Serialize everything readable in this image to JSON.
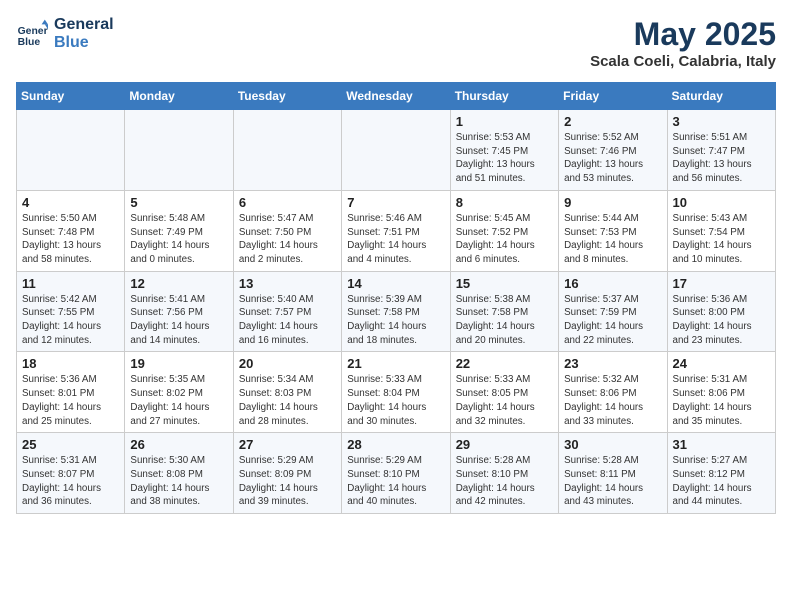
{
  "logo": {
    "line1": "General",
    "line2": "Blue"
  },
  "title": "May 2025",
  "location": "Scala Coeli, Calabria, Italy",
  "weekdays": [
    "Sunday",
    "Monday",
    "Tuesday",
    "Wednesday",
    "Thursday",
    "Friday",
    "Saturday"
  ],
  "weeks": [
    [
      {
        "day": "",
        "info": ""
      },
      {
        "day": "",
        "info": ""
      },
      {
        "day": "",
        "info": ""
      },
      {
        "day": "",
        "info": ""
      },
      {
        "day": "1",
        "info": "Sunrise: 5:53 AM\nSunset: 7:45 PM\nDaylight: 13 hours\nand 51 minutes."
      },
      {
        "day": "2",
        "info": "Sunrise: 5:52 AM\nSunset: 7:46 PM\nDaylight: 13 hours\nand 53 minutes."
      },
      {
        "day": "3",
        "info": "Sunrise: 5:51 AM\nSunset: 7:47 PM\nDaylight: 13 hours\nand 56 minutes."
      }
    ],
    [
      {
        "day": "4",
        "info": "Sunrise: 5:50 AM\nSunset: 7:48 PM\nDaylight: 13 hours\nand 58 minutes."
      },
      {
        "day": "5",
        "info": "Sunrise: 5:48 AM\nSunset: 7:49 PM\nDaylight: 14 hours\nand 0 minutes."
      },
      {
        "day": "6",
        "info": "Sunrise: 5:47 AM\nSunset: 7:50 PM\nDaylight: 14 hours\nand 2 minutes."
      },
      {
        "day": "7",
        "info": "Sunrise: 5:46 AM\nSunset: 7:51 PM\nDaylight: 14 hours\nand 4 minutes."
      },
      {
        "day": "8",
        "info": "Sunrise: 5:45 AM\nSunset: 7:52 PM\nDaylight: 14 hours\nand 6 minutes."
      },
      {
        "day": "9",
        "info": "Sunrise: 5:44 AM\nSunset: 7:53 PM\nDaylight: 14 hours\nand 8 minutes."
      },
      {
        "day": "10",
        "info": "Sunrise: 5:43 AM\nSunset: 7:54 PM\nDaylight: 14 hours\nand 10 minutes."
      }
    ],
    [
      {
        "day": "11",
        "info": "Sunrise: 5:42 AM\nSunset: 7:55 PM\nDaylight: 14 hours\nand 12 minutes."
      },
      {
        "day": "12",
        "info": "Sunrise: 5:41 AM\nSunset: 7:56 PM\nDaylight: 14 hours\nand 14 minutes."
      },
      {
        "day": "13",
        "info": "Sunrise: 5:40 AM\nSunset: 7:57 PM\nDaylight: 14 hours\nand 16 minutes."
      },
      {
        "day": "14",
        "info": "Sunrise: 5:39 AM\nSunset: 7:58 PM\nDaylight: 14 hours\nand 18 minutes."
      },
      {
        "day": "15",
        "info": "Sunrise: 5:38 AM\nSunset: 7:58 PM\nDaylight: 14 hours\nand 20 minutes."
      },
      {
        "day": "16",
        "info": "Sunrise: 5:37 AM\nSunset: 7:59 PM\nDaylight: 14 hours\nand 22 minutes."
      },
      {
        "day": "17",
        "info": "Sunrise: 5:36 AM\nSunset: 8:00 PM\nDaylight: 14 hours\nand 23 minutes."
      }
    ],
    [
      {
        "day": "18",
        "info": "Sunrise: 5:36 AM\nSunset: 8:01 PM\nDaylight: 14 hours\nand 25 minutes."
      },
      {
        "day": "19",
        "info": "Sunrise: 5:35 AM\nSunset: 8:02 PM\nDaylight: 14 hours\nand 27 minutes."
      },
      {
        "day": "20",
        "info": "Sunrise: 5:34 AM\nSunset: 8:03 PM\nDaylight: 14 hours\nand 28 minutes."
      },
      {
        "day": "21",
        "info": "Sunrise: 5:33 AM\nSunset: 8:04 PM\nDaylight: 14 hours\nand 30 minutes."
      },
      {
        "day": "22",
        "info": "Sunrise: 5:33 AM\nSunset: 8:05 PM\nDaylight: 14 hours\nand 32 minutes."
      },
      {
        "day": "23",
        "info": "Sunrise: 5:32 AM\nSunset: 8:06 PM\nDaylight: 14 hours\nand 33 minutes."
      },
      {
        "day": "24",
        "info": "Sunrise: 5:31 AM\nSunset: 8:06 PM\nDaylight: 14 hours\nand 35 minutes."
      }
    ],
    [
      {
        "day": "25",
        "info": "Sunrise: 5:31 AM\nSunset: 8:07 PM\nDaylight: 14 hours\nand 36 minutes."
      },
      {
        "day": "26",
        "info": "Sunrise: 5:30 AM\nSunset: 8:08 PM\nDaylight: 14 hours\nand 38 minutes."
      },
      {
        "day": "27",
        "info": "Sunrise: 5:29 AM\nSunset: 8:09 PM\nDaylight: 14 hours\nand 39 minutes."
      },
      {
        "day": "28",
        "info": "Sunrise: 5:29 AM\nSunset: 8:10 PM\nDaylight: 14 hours\nand 40 minutes."
      },
      {
        "day": "29",
        "info": "Sunrise: 5:28 AM\nSunset: 8:10 PM\nDaylight: 14 hours\nand 42 minutes."
      },
      {
        "day": "30",
        "info": "Sunrise: 5:28 AM\nSunset: 8:11 PM\nDaylight: 14 hours\nand 43 minutes."
      },
      {
        "day": "31",
        "info": "Sunrise: 5:27 AM\nSunset: 8:12 PM\nDaylight: 14 hours\nand 44 minutes."
      }
    ]
  ]
}
